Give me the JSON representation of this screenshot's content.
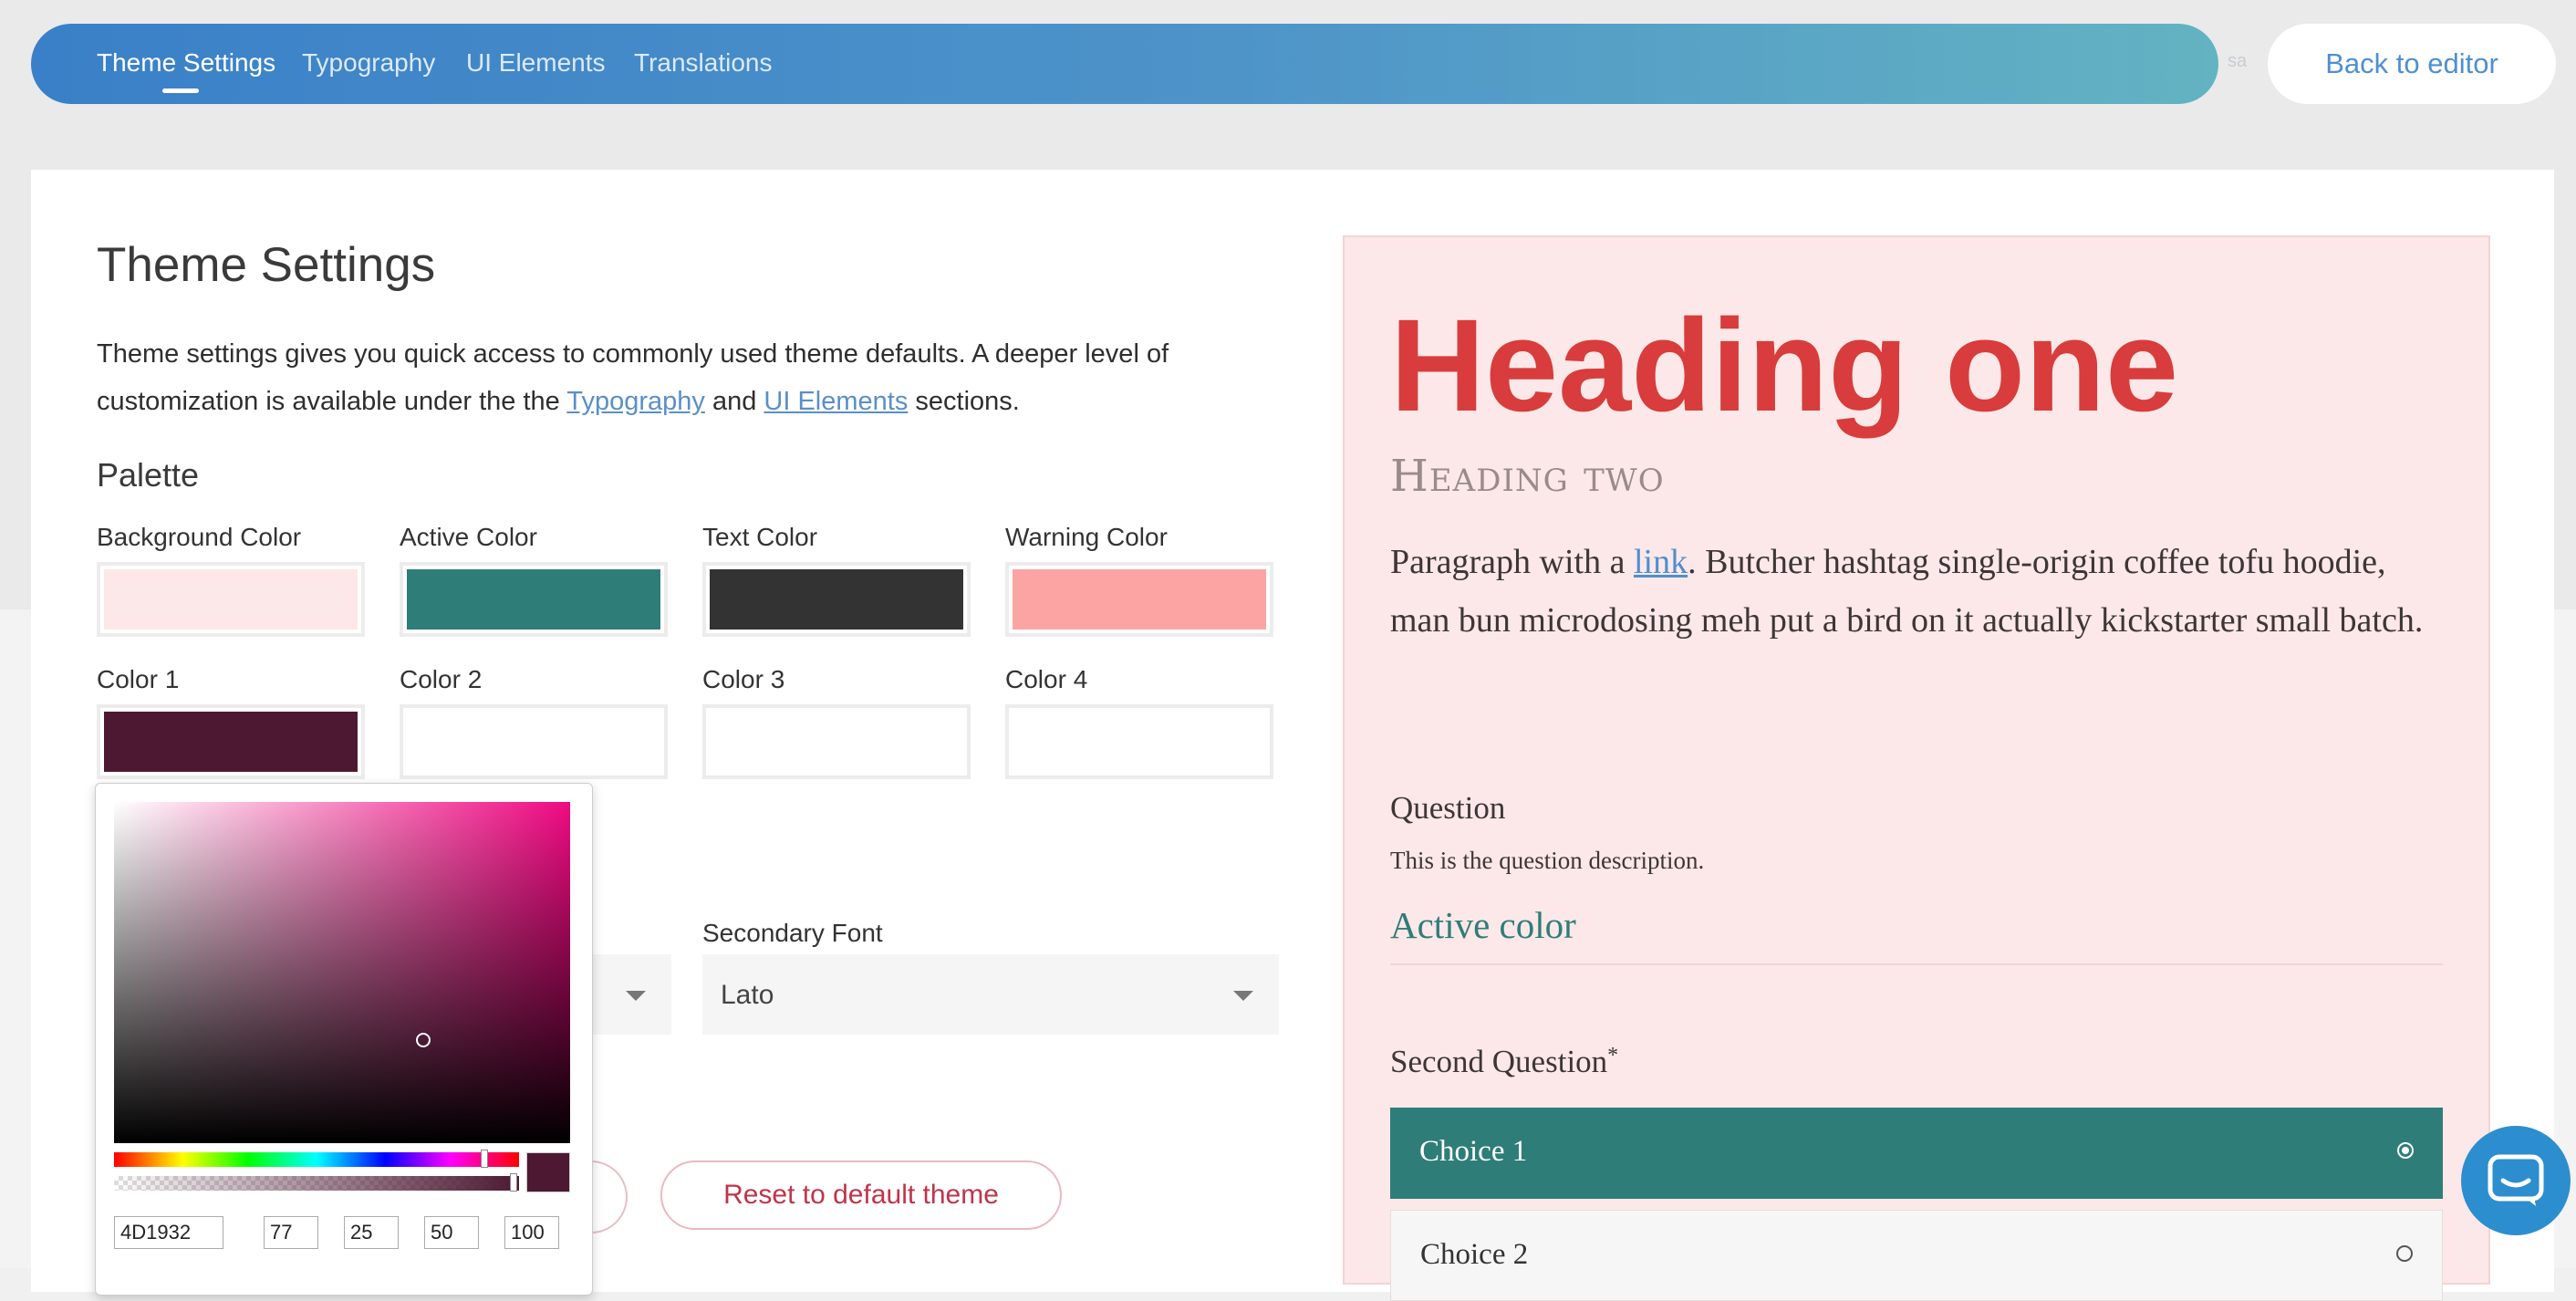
{
  "nav": {
    "tabs": [
      {
        "label": "Theme Settings",
        "active": true
      },
      {
        "label": "Typography"
      },
      {
        "label": "UI Elements"
      },
      {
        "label": "Translations"
      }
    ],
    "save_hint": "sa",
    "back_label": "Back to editor"
  },
  "settings": {
    "title": "Theme Settings",
    "desc_before": "Theme settings gives you quick access to commonly used theme defaults. A deeper level of customization is available under the the ",
    "desc_link1": "Typography",
    "desc_and": " and ",
    "desc_link2": "UI Elements",
    "desc_after": " sections.",
    "palette_title": "Palette",
    "colors": [
      {
        "label": "Background Color",
        "hex": "#fce8e8"
      },
      {
        "label": "Active Color",
        "hex": "#2f7d78"
      },
      {
        "label": "Text Color",
        "hex": "#333333"
      },
      {
        "label": "Warning Color",
        "hex": "#fca4a4"
      },
      {
        "label": "Color 1",
        "hex": "#4d1932"
      },
      {
        "label": "Color 2",
        "hex": ""
      },
      {
        "label": "Color 3",
        "hex": ""
      },
      {
        "label": "Color 4",
        "hex": ""
      }
    ],
    "secondary_font_label": "Secondary Font",
    "secondary_font_value": "Lato",
    "reset_label": "Reset to default theme"
  },
  "picker": {
    "hex": "4D1932",
    "r": "77",
    "g": "25",
    "b": "50",
    "a": "100",
    "hue_color": "#f00a82",
    "current_color": "#4d1932"
  },
  "preview": {
    "heading_one": "Heading one",
    "heading_two": "Heading two",
    "para_before": "Paragraph with a ",
    "para_link": "link",
    "para_after": ". Butcher hashtag single-origin coffee tofu hoodie, man bun microdosing meh put a bird on it actually kickstarter small batch.",
    "question": "Question",
    "question_desc": "This is the question description.",
    "active_color_label": "Active color",
    "second_question": "Second Question",
    "required_mark": "*",
    "choices": [
      {
        "label": "Choice 1",
        "selected": true
      },
      {
        "label": "Choice 2",
        "selected": false
      }
    ]
  },
  "icons": {
    "chat": "chat-bubble-icon",
    "dropdown": "chevron-down-icon"
  }
}
